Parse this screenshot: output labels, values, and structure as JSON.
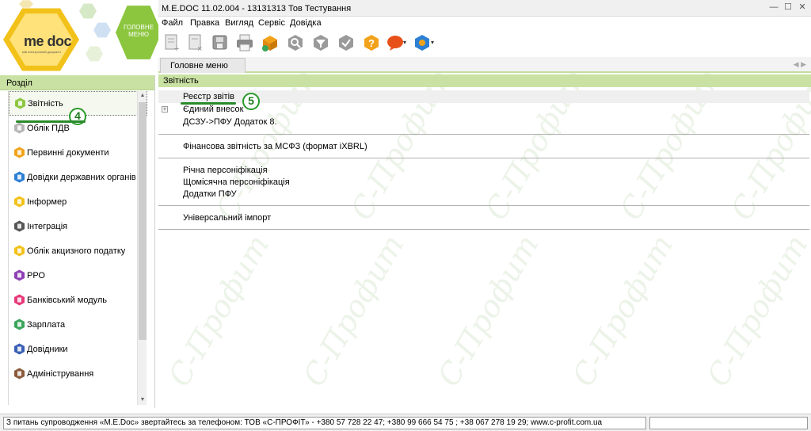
{
  "logo": {
    "brand": "me doc",
    "tagline": "мій електронний документ",
    "menu_button": "ГОЛОВНЕ МЕНЮ"
  },
  "window": {
    "title": "M.E.DOC 11.02.004 - 13131313 Тов Тестування"
  },
  "menu": [
    "Файл",
    "Правка",
    "Вигляд",
    "Сервіс",
    "Довідка"
  ],
  "tabs": {
    "active": "Головне меню"
  },
  "sidebar": {
    "title": "Розділ",
    "items": [
      {
        "label": "Звітність",
        "icon": "reports-icon",
        "color": "#8cc63f"
      },
      {
        "label": "Облік ПДВ",
        "icon": "vat-icon",
        "color": "#b5b5b5"
      },
      {
        "label": "Первинні документи",
        "icon": "primary-docs-icon",
        "color": "#f2a21a"
      },
      {
        "label": "Довідки державних органів",
        "icon": "gov-certificates-icon",
        "color": "#2b7fd4"
      },
      {
        "label": "Інформер",
        "icon": "informer-icon",
        "color": "#f2c21a"
      },
      {
        "label": "Інтеграція",
        "icon": "integration-icon",
        "color": "#555555"
      },
      {
        "label": "Облік акцизного податку",
        "icon": "excise-icon",
        "color": "#f2c21a"
      },
      {
        "label": "РРО",
        "icon": "rro-icon",
        "color": "#8e3fb5"
      },
      {
        "label": "Банківський модуль",
        "icon": "bank-icon",
        "color": "#e63a7a"
      },
      {
        "label": "Зарплата",
        "icon": "salary-icon",
        "color": "#3aa55a"
      },
      {
        "label": "Довідники",
        "icon": "directories-icon",
        "color": "#3a5fb5"
      },
      {
        "label": "Адміністрування",
        "icon": "admin-icon",
        "color": "#8a5a3a"
      }
    ]
  },
  "content": {
    "header": "Звітність",
    "groups": [
      [
        "Реєстр звітів",
        "Єдиний внесок",
        "ДСЗУ->ПФУ Додаток 8."
      ],
      [
        "Фінансова звітність за МСФЗ (формат iXBRL)"
      ],
      [
        "Річна персоніфікація",
        "Щомісячна персоніфікація",
        "Додатки ПФУ"
      ],
      [
        "Універсальний імпорт"
      ]
    ]
  },
  "annotations": {
    "sidebar_marker": "4",
    "content_marker": "5"
  },
  "watermark": "С-Профит",
  "statusbar": {
    "text": "З питань супроводження «M.E.Doc» звертайтесь за телефоном: ТОВ «С-ПРОФІТ» - +380 57 728 22 47; +380 99 666 54 75 ; +38 067 278 19 29; www.c-profit.com.ua"
  },
  "colors": {
    "accent_green": "#c9e2a3",
    "annotation": "#2a9a2a"
  }
}
